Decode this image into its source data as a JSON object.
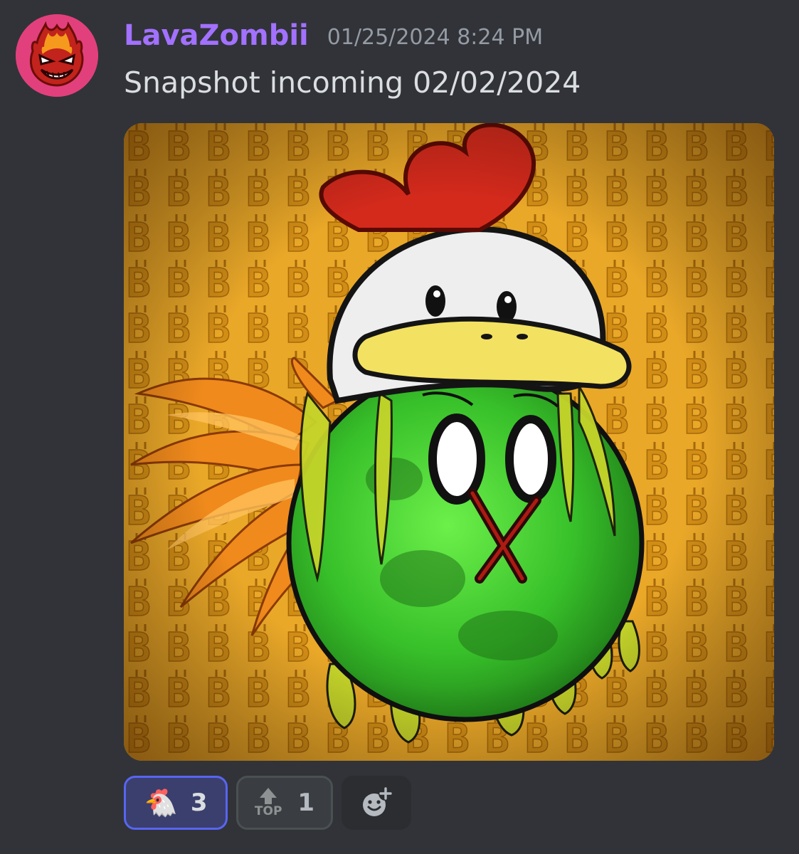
{
  "message": {
    "author": "LavaZombii",
    "timestamp": "01/25/2024 8:24 PM",
    "content": "Snapshot incoming 02/02/2024",
    "avatar_icon": "flaming-angry-face-avatar",
    "attachment_icon": "zombie-chicken-nft-artwork"
  },
  "reactions": [
    {
      "emoji": "🐔",
      "count": "3",
      "state": "reacted"
    },
    {
      "emoji": "TOP",
      "count": "1",
      "state": "not-reacted"
    }
  ],
  "add_reaction_icon": "add-reaction-icon",
  "colors": {
    "background": "#313338",
    "username": "#a271ff",
    "timestamp": "#949ba4",
    "text": "#dbdee1",
    "reaction_active_border": "#5865f2",
    "reaction_active_bg": "#3b3f6e"
  }
}
